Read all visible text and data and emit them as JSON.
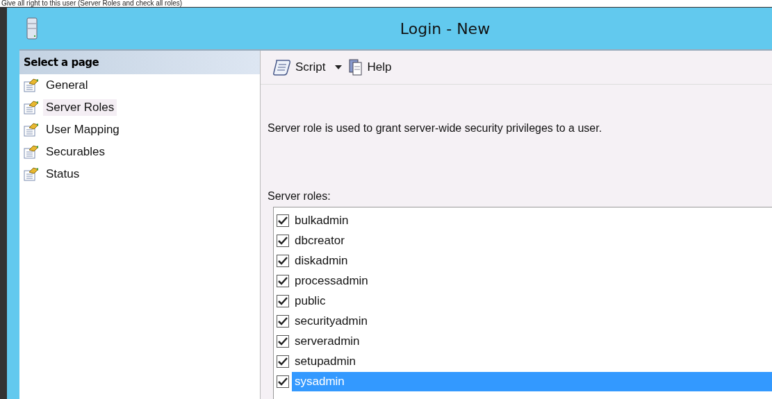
{
  "caption": "Give all right to this user (Server Roles and check all roles)",
  "window": {
    "title": "Login - New"
  },
  "sidebar": {
    "header": "Select a page",
    "items": [
      {
        "label": "General",
        "selected": false
      },
      {
        "label": "Server Roles",
        "selected": true
      },
      {
        "label": "User Mapping",
        "selected": false
      },
      {
        "label": "Securables",
        "selected": false
      },
      {
        "label": "Status",
        "selected": false
      }
    ]
  },
  "toolbar": {
    "items": [
      {
        "label": "Script",
        "kind": "script"
      },
      {
        "label": "Help",
        "kind": "help"
      }
    ]
  },
  "description": "Server role is used to grant server-wide security privileges to a user.",
  "roles_label": "Server roles:",
  "roles": [
    {
      "name": "bulkadmin",
      "checked": true,
      "selected": false
    },
    {
      "name": "dbcreator",
      "checked": true,
      "selected": false
    },
    {
      "name": "diskadmin",
      "checked": true,
      "selected": false
    },
    {
      "name": "processadmin",
      "checked": true,
      "selected": false
    },
    {
      "name": "public",
      "checked": true,
      "selected": false
    },
    {
      "name": "securityadmin",
      "checked": true,
      "selected": false
    },
    {
      "name": "serveradmin",
      "checked": true,
      "selected": false
    },
    {
      "name": "setupadmin",
      "checked": true,
      "selected": false
    },
    {
      "name": "sysadmin",
      "checked": true,
      "selected": true
    }
  ]
}
